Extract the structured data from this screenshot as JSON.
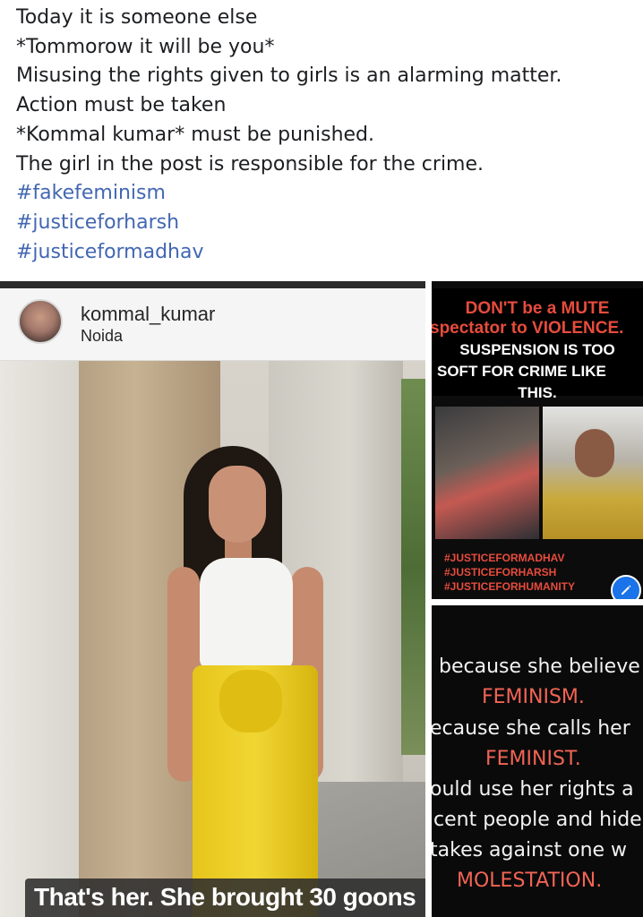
{
  "post": {
    "lines": [
      "Today it is someone else",
      "*Tommorow it will be you*",
      "Misusing the rights given to girls is an alarming matter.",
      "Action must be taken",
      "*Kommal kumar* must be punished.",
      "The girl in the post is responsible for the crime."
    ],
    "hashtags": [
      "#fakefeminism",
      "#justiceforharsh",
      "#justiceformadhav"
    ]
  },
  "photo_left": {
    "username": "kommal_kumar",
    "location": "Noida",
    "caption": "That's her. She brought 30 goons"
  },
  "photo_right_top": {
    "line1": "DON'T be a MUTE",
    "line2": "spectator to VIOLENCE.",
    "line3": "SUSPENSION IS TOO",
    "line4": "SOFT FOR CRIME LIKE",
    "line5": "THIS.",
    "tags": [
      "#JUSTICEFORMADHAV",
      "#JUSTICEFORHARSH",
      "#JUSTICEFORHUMANITY"
    ]
  },
  "photo_right_bottom": {
    "line1": "because she believe",
    "line2": "FEMINISM.",
    "line3": "ecause she calls her",
    "line4": "FEMINIST.",
    "line5": "ould use her rights a",
    "line6": "cent people and hide",
    "line7": "takes against one w",
    "line8": "MOLESTATION."
  },
  "icons": {
    "edit": "pencil-icon"
  },
  "colors": {
    "hashtag": "#4267b2",
    "poster_red": "#e74c3c",
    "edit_button": "#1a73e8"
  }
}
